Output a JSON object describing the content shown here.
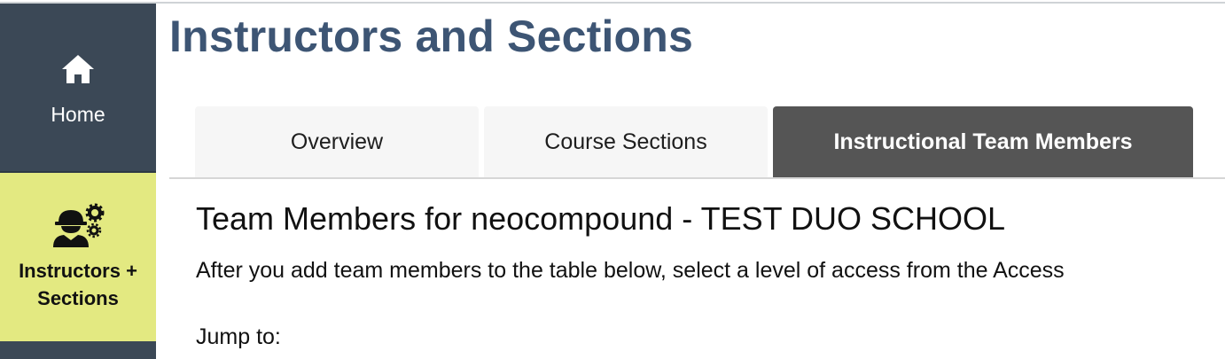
{
  "sidebar": {
    "items": [
      {
        "label": "Home",
        "icon": "home-icon",
        "active": false
      },
      {
        "label": "Instructors +\nSections",
        "label_line1": "Instructors +",
        "label_line2": "Sections",
        "icon": "instructor-gears-icon",
        "active": true
      }
    ],
    "colors": {
      "background": "#3b4856",
      "active": "#e3e981"
    }
  },
  "page": {
    "title": "Instructors and Sections",
    "title_color": "#3d5574"
  },
  "tabs": [
    {
      "label": "Overview",
      "active": false
    },
    {
      "label": "Course Sections",
      "active": false
    },
    {
      "label": "Instructional Team Members",
      "active": true
    }
  ],
  "content": {
    "heading": "Team Members for neocompound - TEST DUO SCHOOL",
    "intro": "After you add team members to the table below, select a level of access from the Access",
    "jump_label": "Jump to:"
  }
}
